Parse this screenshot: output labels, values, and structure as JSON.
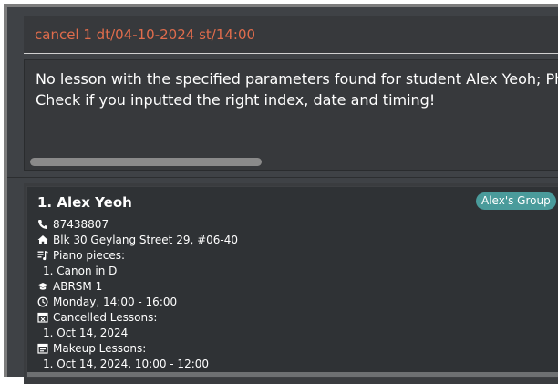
{
  "command_box": {
    "text": "cancel 1 dt/04-10-2024 st/14:00"
  },
  "result_box": {
    "line1": "No lesson with the specified parameters found for student Alex Yeoh; Phon",
    "line2": "Check if you inputted the right index, date and timing!"
  },
  "student": {
    "name": "1. Alex Yeoh",
    "group": "Alex's Group",
    "phone": "87438807",
    "address": "Blk 30 Geylang Street 29, #06-40",
    "pieces_label": "Piano pieces:",
    "piece_1": "1. Canon in D",
    "grade": "ABRSM 1",
    "schedule": "Monday, 14:00 - 16:00",
    "cancelled_label": "Cancelled Lessons:",
    "cancelled_1": "1. Oct 14, 2024",
    "makeup_label": "Makeup Lessons:",
    "makeup_1": "1. Oct 14, 2024, 10:00 - 12:00"
  },
  "colors": {
    "command_text": "#e06c4c",
    "badge": "#4a9b9b"
  }
}
